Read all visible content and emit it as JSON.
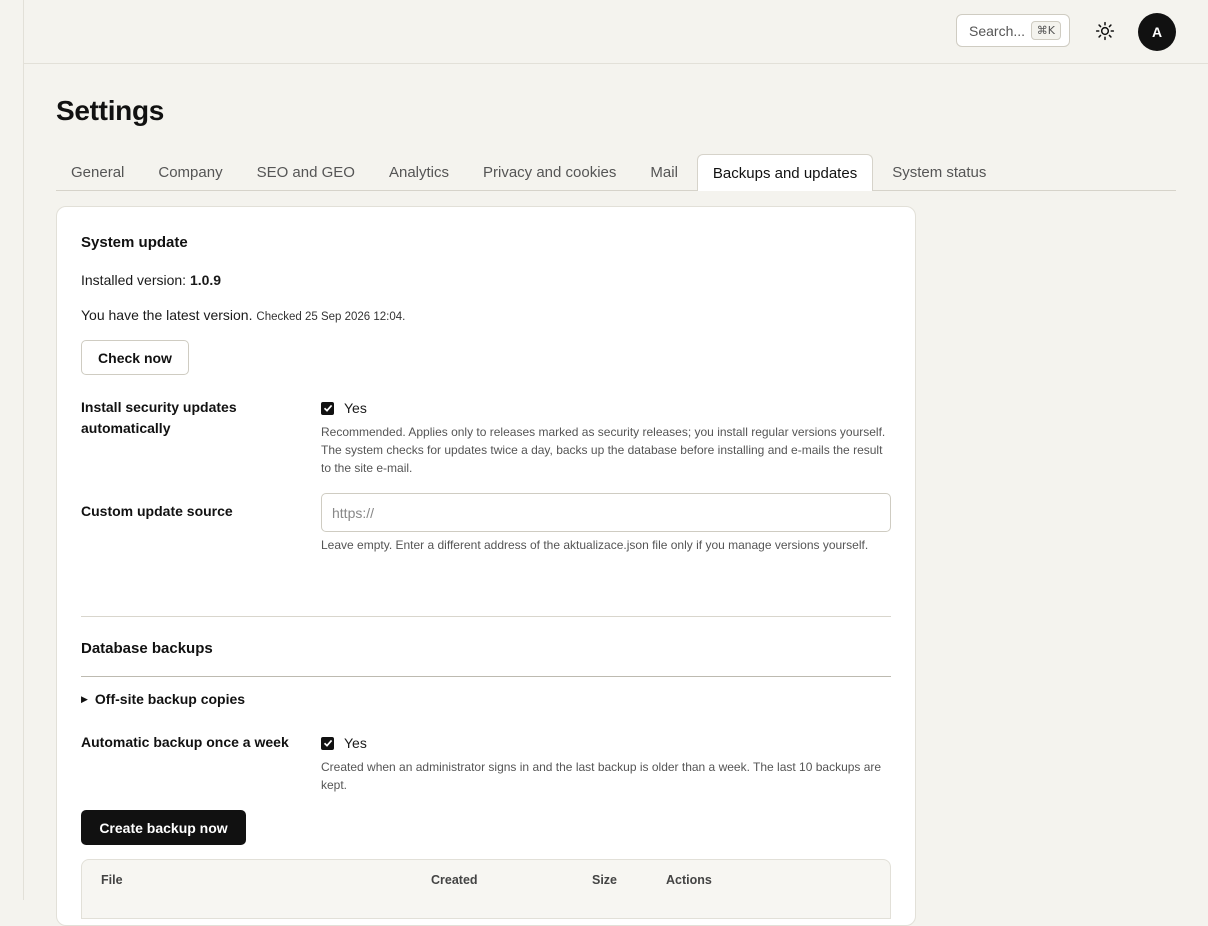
{
  "header": {
    "search_label": "Search...",
    "search_shortcut": "⌘K",
    "theme_icon": "sun-icon",
    "avatar_initial": "A"
  },
  "page": {
    "title": "Settings"
  },
  "tabs": [
    {
      "label": "General",
      "active": false
    },
    {
      "label": "Company",
      "active": false
    },
    {
      "label": "SEO and GEO",
      "active": false
    },
    {
      "label": "Analytics",
      "active": false
    },
    {
      "label": "Privacy and cookies",
      "active": false
    },
    {
      "label": "Mail",
      "active": false
    },
    {
      "label": "Backups and updates",
      "active": true
    },
    {
      "label": "System status",
      "active": false
    }
  ],
  "system_update": {
    "title": "System update",
    "installed_prefix": "Installed version:",
    "installed_version": "1.0.9",
    "status_text": "You have the latest version.",
    "checked_text": "Checked 25 Sep 2026 12:04.",
    "check_button": "Check now",
    "auto_security": {
      "label": "Install security updates automatically",
      "checkbox_label": "Yes",
      "checked": true,
      "help": "Recommended. Applies only to releases marked as security releases; you install regular versions yourself. The system checks for updates twice a day, backs up the database before installing and e-mails the result to the site e-mail."
    },
    "custom_source": {
      "label": "Custom update source",
      "placeholder": "https://",
      "value": "",
      "help": "Leave empty. Enter a different address of the aktualizace.json file only if you manage versions yourself."
    }
  },
  "database_backups": {
    "title": "Database backups",
    "offsite_label": "Off-site backup copies",
    "auto_backup": {
      "label": "Automatic backup once a week",
      "checkbox_label": "Yes",
      "checked": true,
      "help": "Created when an administrator signs in and the last backup is older than a week. The last 10 backups are kept."
    },
    "create_button": "Create backup now",
    "table": {
      "columns": [
        "File",
        "Created",
        "Size",
        "Actions"
      ]
    }
  },
  "colors": {
    "background": "#f4f3ee",
    "card": "#ffffff",
    "accent_dark": "#111111",
    "border": "#e2e0d8"
  }
}
